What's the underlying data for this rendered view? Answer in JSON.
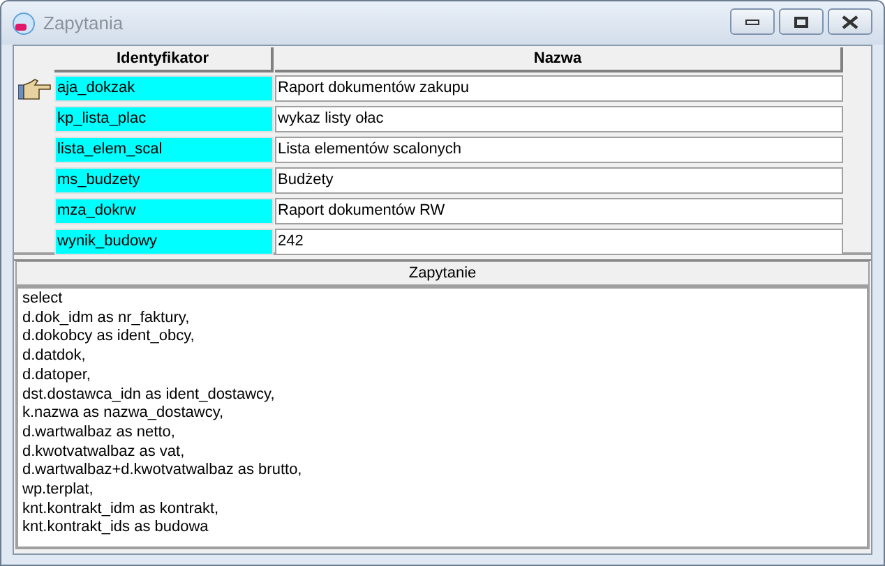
{
  "window": {
    "title": "Zapytania"
  },
  "table": {
    "columns": [
      "Identyfikator",
      "Nazwa"
    ],
    "rows": [
      {
        "current": true,
        "cells": [
          "aja_dokzak",
          "Raport dokumentów zakupu"
        ]
      },
      {
        "current": false,
        "cells": [
          "kp_lista_plac",
          "wykaz listy ołac"
        ]
      },
      {
        "current": false,
        "cells": [
          "lista_elem_scal",
          "Lista elementów scalonych"
        ]
      },
      {
        "current": false,
        "cells": [
          "ms_budzety",
          "Budżety"
        ]
      },
      {
        "current": false,
        "cells": [
          "mza_dokrw",
          "Raport dokumentów RW"
        ]
      },
      {
        "current": false,
        "cells": [
          "wynik_budowy",
          "242"
        ]
      }
    ]
  },
  "query": {
    "heading": "Zapytanie",
    "lines": [
      "select",
      "d.dok_idm as nr_faktury,",
      "d.dokobcy as ident_obcy,",
      "d.datdok,",
      "d.datoper,",
      "dst.dostawca_idn as ident_dostawcy,",
      "k.nazwa as nazwa_dostawcy,",
      "d.wartwalbaz as netto,",
      "d.kwotvatwalbaz as vat,",
      "d.wartwalbaz+d.kwotvatwalbaz as brutto,",
      "wp.terplat,",
      "knt.kontrakt_idm as kontrakt,",
      "knt.kontrakt_ids as budowa"
    ]
  }
}
